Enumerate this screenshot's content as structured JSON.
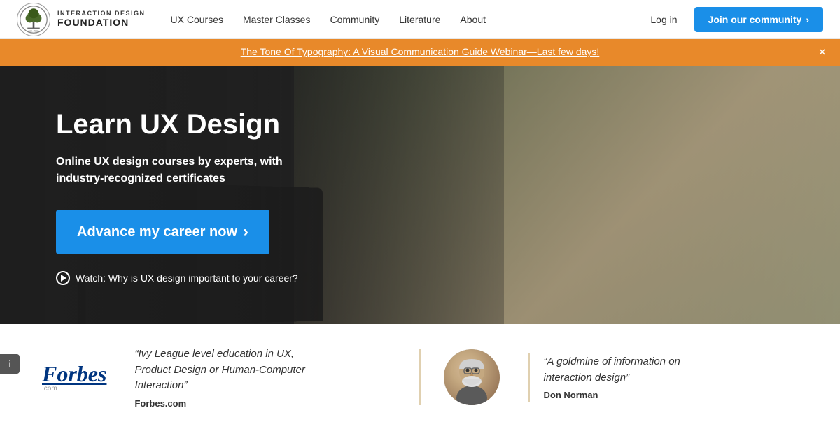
{
  "navbar": {
    "logo": {
      "line1": "INTERACTION DESIGN",
      "line2": "FOUNDATION",
      "est": "Est. 2002"
    },
    "nav_links": [
      {
        "label": "UX Courses",
        "id": "ux-courses"
      },
      {
        "label": "Master Classes",
        "id": "master-classes"
      },
      {
        "label": "Community",
        "id": "community"
      },
      {
        "label": "Literature",
        "id": "literature"
      },
      {
        "label": "About",
        "id": "about"
      }
    ],
    "login_label": "Log in",
    "join_label": "Join our community",
    "join_chevron": "›"
  },
  "announcement": {
    "text": "The Tone Of Typography: A Visual Communication Guide Webinar—Last few days!",
    "close_icon": "×"
  },
  "hero": {
    "title": "Learn UX Design",
    "subtitle": "Online UX design courses by experts, with\nindustry-recognized certificates",
    "cta_label": "Advance my career now",
    "cta_chevron": "›",
    "watch_label": "Watch: Why is UX design important to your career?"
  },
  "social_proof": {
    "forbes": {
      "logo": "Forbes",
      "com": ".com",
      "quote": "“Ivy League level education in UX, Product Design or Human-Computer Interaction”",
      "source": "Forbes.com"
    },
    "don_norman": {
      "quote": "“A goldmine of information on interaction design”",
      "name": "Don Norman"
    }
  },
  "info_button": {
    "label": "i"
  }
}
